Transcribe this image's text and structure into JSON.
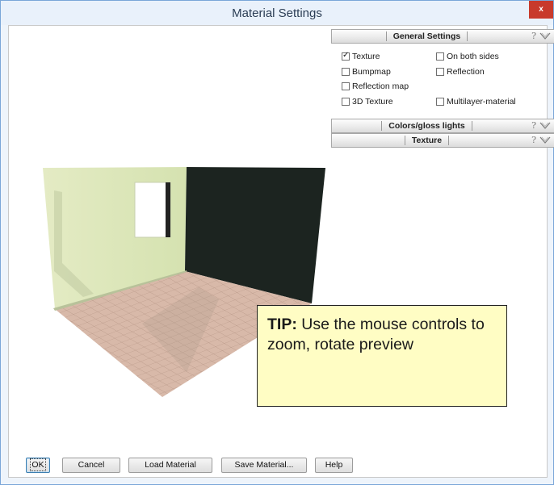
{
  "window": {
    "title": "Material Settings",
    "close_label": "x"
  },
  "panels": {
    "general": {
      "label": "General Settings",
      "help": "?"
    },
    "colors": {
      "label": "Colors/gloss lights",
      "help": "?"
    },
    "texture": {
      "label": "Texture",
      "help": "?"
    }
  },
  "general_options": {
    "texture": {
      "label": "Texture",
      "checked": true
    },
    "on_both_sides": {
      "label": "On both sides",
      "checked": false
    },
    "bumpmap": {
      "label": "Bumpmap",
      "checked": false
    },
    "reflection": {
      "label": "Reflection",
      "checked": false
    },
    "reflection_map": {
      "label": "Reflection map",
      "checked": false
    },
    "texture_3d": {
      "label": "3D Texture",
      "checked": false
    },
    "multilayer": {
      "label": "Multilayer-material",
      "checked": false
    }
  },
  "tip": {
    "prefix": "TIP:",
    "text": "Use the mouse controls to zoom, rotate preview"
  },
  "buttons": {
    "ok": "OK",
    "cancel": "Cancel",
    "load": "Load Material",
    "save": "Save Material...",
    "help": "Help"
  },
  "colors": {
    "accent_close": "#c83a2c",
    "tip_bg": "#fffdc4",
    "window_frame": "#7aa6d8"
  }
}
